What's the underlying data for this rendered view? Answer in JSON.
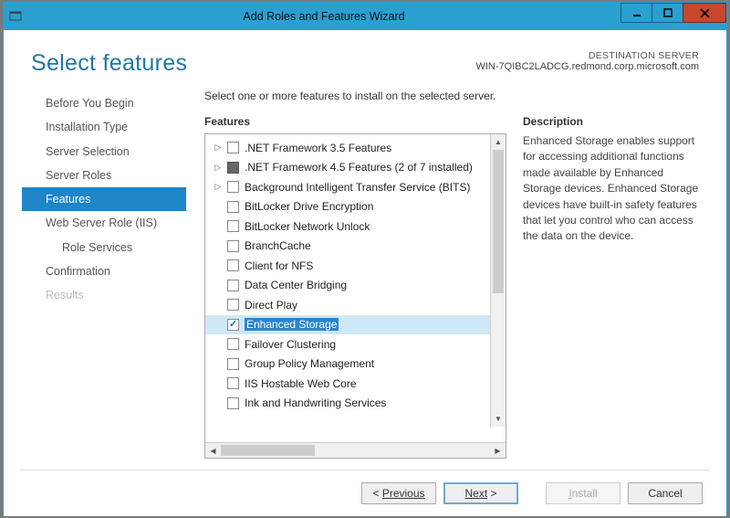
{
  "window": {
    "title": "Add Roles and Features Wizard"
  },
  "header": {
    "title": "Select features",
    "dest_label": "DESTINATION SERVER",
    "dest_server": "WIN-7QIBC2LADCG.redmond.corp.microsoft.com"
  },
  "nav": {
    "items": [
      {
        "label": "Before You Begin",
        "active": false
      },
      {
        "label": "Installation Type",
        "active": false
      },
      {
        "label": "Server Selection",
        "active": false
      },
      {
        "label": "Server Roles",
        "active": false
      },
      {
        "label": "Features",
        "active": true
      },
      {
        "label": "Web Server Role (IIS)",
        "active": false
      },
      {
        "label": "Role Services",
        "active": false,
        "sub": true
      },
      {
        "label": "Confirmation",
        "active": false
      },
      {
        "label": "Results",
        "active": false,
        "disabled": true
      }
    ]
  },
  "main": {
    "instruction": "Select one or more features to install on the selected server.",
    "features_label": "Features",
    "description_label": "Description",
    "description_text": "Enhanced Storage enables support for accessing additional functions made available by Enhanced Storage devices. Enhanced Storage devices have built-in safety features that let you control who can access the data on the device.",
    "features": [
      {
        "label": ".NET Framework 3.5 Features",
        "expander": true,
        "state": "unchecked"
      },
      {
        "label": ".NET Framework 4.5 Features (2 of 7 installed)",
        "expander": true,
        "state": "partial"
      },
      {
        "label": "Background Intelligent Transfer Service (BITS)",
        "expander": true,
        "state": "unchecked"
      },
      {
        "label": "BitLocker Drive Encryption",
        "expander": false,
        "state": "unchecked"
      },
      {
        "label": "BitLocker Network Unlock",
        "expander": false,
        "state": "unchecked"
      },
      {
        "label": "BranchCache",
        "expander": false,
        "state": "unchecked"
      },
      {
        "label": "Client for NFS",
        "expander": false,
        "state": "unchecked"
      },
      {
        "label": "Data Center Bridging",
        "expander": false,
        "state": "unchecked"
      },
      {
        "label": "Direct Play",
        "expander": false,
        "state": "unchecked"
      },
      {
        "label": "Enhanced Storage",
        "expander": false,
        "state": "checked",
        "selected": true
      },
      {
        "label": "Failover Clustering",
        "expander": false,
        "state": "unchecked"
      },
      {
        "label": "Group Policy Management",
        "expander": false,
        "state": "unchecked"
      },
      {
        "label": "IIS Hostable Web Core",
        "expander": false,
        "state": "unchecked"
      },
      {
        "label": "Ink and Handwriting Services",
        "expander": false,
        "state": "unchecked"
      }
    ]
  },
  "footer": {
    "previous": "Previous",
    "next": "Next",
    "install": "Install",
    "cancel": "Cancel"
  }
}
